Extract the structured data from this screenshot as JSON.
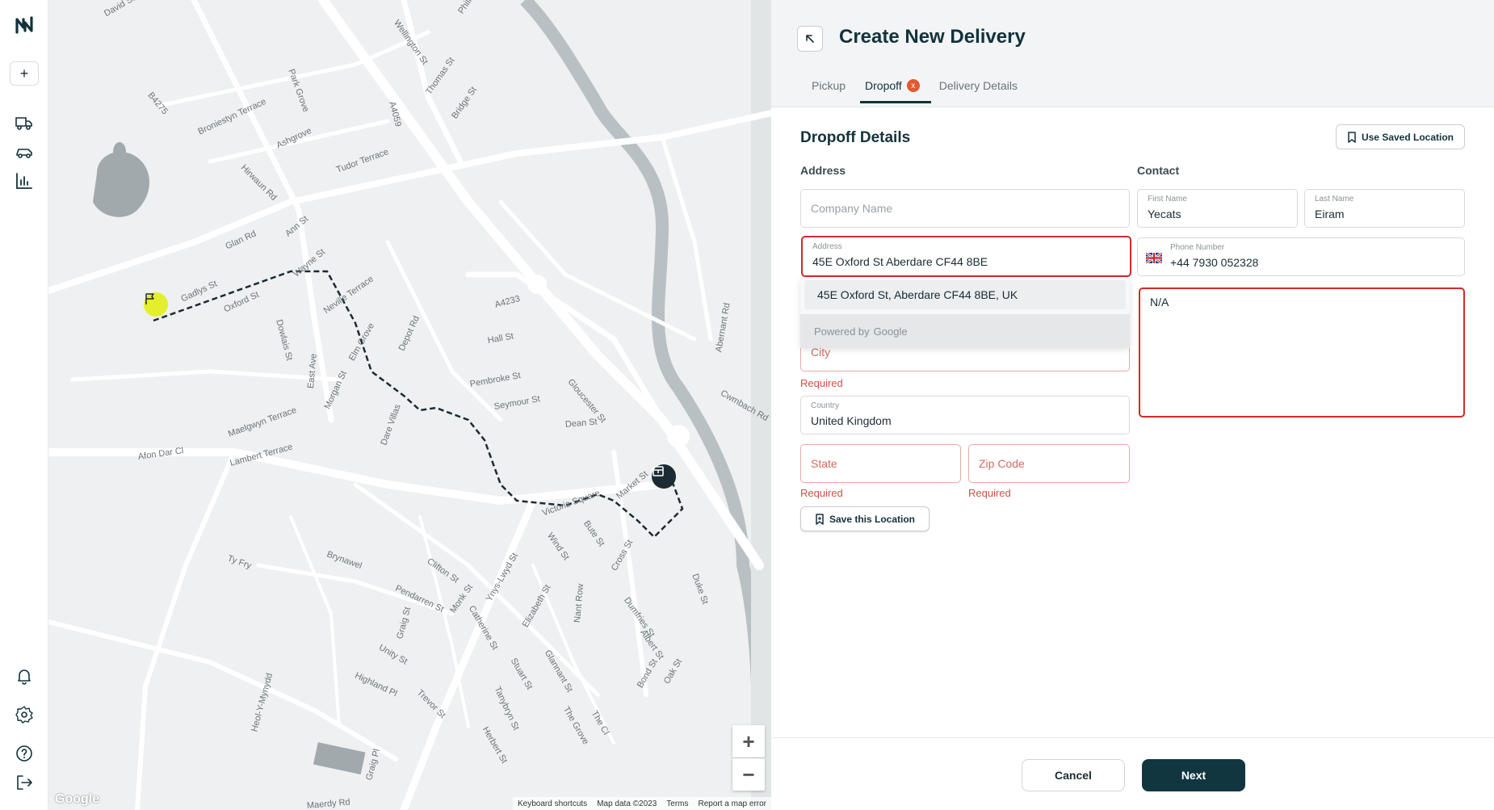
{
  "header": {
    "title": "Create New Delivery",
    "tabs": [
      {
        "label": "Pickup"
      },
      {
        "label": "Dropoff",
        "error_icon": "x"
      },
      {
        "label": "Delivery Details"
      }
    ]
  },
  "form": {
    "section_title": "Dropoff Details",
    "use_saved_label": "Use Saved Location",
    "address_label": "Address",
    "contact_label": "Contact",
    "company_placeholder": "Company Name",
    "address_field_label": "Address",
    "address_value": "45E Oxford St Aberdare CF44 8BE",
    "suggestion": "45E Oxford St, Aberdare CF44 8BE, UK",
    "powered_by": "Powered by",
    "google_word": "Google",
    "city_placeholder": "City",
    "required_text": "Required",
    "country_label": "Country",
    "country_value": "United Kingdom",
    "state_placeholder": "State",
    "zip_placeholder": "Zip Code",
    "save_location_label": "Save this Location",
    "first_name_label": "First Name",
    "first_name_value": "Yecats",
    "last_name_label": "Last Name",
    "last_name_value": "Eiram",
    "phone_label": "Phone Number",
    "phone_value": "+44 7930 052328",
    "notes_value": "N/A"
  },
  "footer": {
    "cancel_label": "Cancel",
    "next_label": "Next"
  },
  "map": {
    "zoom_in": "+",
    "zoom_out": "−",
    "footer_links": [
      "Keyboard shortcuts",
      "Map data ©2023",
      "Terms",
      "Report a map error"
    ],
    "watermark": "Google",
    "street_labels": [
      "David St",
      "Wellington St",
      "Phillip St",
      "Thomas St",
      "Bridge St",
      "Park Grove",
      "B4275",
      "Broniestyn Terrace",
      "Ashgrove",
      "Tudor Terrace",
      "Hirwaun Rd",
      "A4059",
      "Glan Rd",
      "Ann St",
      "Wayne St",
      "Gadlys St",
      "Oxford St",
      "Dowlais St",
      "Neville Terrace",
      "A4233",
      "Elm Grove",
      "Depot Rd",
      "Hall St",
      "Pembroke St",
      "Seymour St",
      "Gloucester St",
      "Dean St",
      "Maelgwyn Terrace",
      "Morgan St",
      "Dare Villas",
      "East Ave",
      "Afon Dar Cl",
      "Lambert Terrace",
      "Abernant Rd",
      "Cwmbach Rd",
      "Market St",
      "Victoria Square",
      "Bute St",
      "Wind St",
      "Duke St",
      "Cross St",
      "Dumfries St",
      "Ty Fry",
      "Brynawel",
      "Clifton St",
      "Pendarren St",
      "Monk St",
      "Catherine St",
      "Ynys-Lwyd St",
      "Elizabeth St",
      "Nant Row",
      "Albert St",
      "Highland Pl",
      "Unity St",
      "Graig St",
      "Stuart St",
      "Glannant St",
      "Tanybryn St",
      "The Grove",
      "Herbert St",
      "Trevor St",
      "Heol-Y-Mynydd",
      "Graig Pl",
      "Bond St",
      "Oak St",
      "The Cl",
      "Maerdy Rd"
    ]
  },
  "rail": {
    "add_label": "+"
  }
}
